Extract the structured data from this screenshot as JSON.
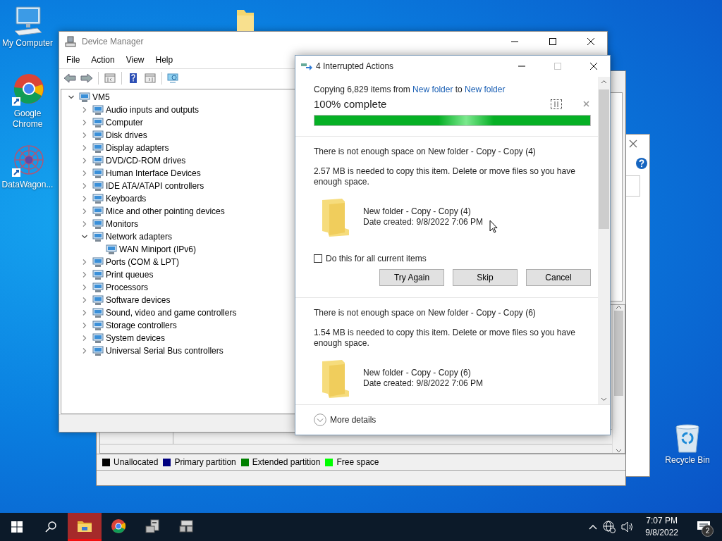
{
  "desktop_icons": [
    {
      "label": "My Computer",
      "kind": "computer"
    },
    {
      "label": "Google Chrome",
      "kind": "browser"
    },
    {
      "label": "DataWagon...",
      "kind": "pattern"
    },
    {
      "label": "Recycle Bin",
      "kind": "recycle"
    }
  ],
  "disk_management": {
    "legend": [
      {
        "label": "Unallocated",
        "color": "#000000"
      },
      {
        "label": "Primary partition",
        "color": "#000080"
      },
      {
        "label": "Extended partition",
        "color": "#008000"
      },
      {
        "label": "Free space",
        "color": "#00ff00"
      }
    ]
  },
  "device_manager": {
    "title": "Device Manager",
    "menu": [
      "File",
      "Action",
      "View",
      "Help"
    ],
    "tree": {
      "label": "VM5",
      "expanded": true,
      "children": [
        {
          "label": "Audio inputs and outputs",
          "expanded": false
        },
        {
          "label": "Computer",
          "expanded": false
        },
        {
          "label": "Disk drives",
          "expanded": false
        },
        {
          "label": "Display adapters",
          "expanded": false
        },
        {
          "label": "DVD/CD-ROM drives",
          "expanded": false
        },
        {
          "label": "Human Interface Devices",
          "expanded": false
        },
        {
          "label": "IDE ATA/ATAPI controllers",
          "expanded": false
        },
        {
          "label": "Keyboards",
          "expanded": false
        },
        {
          "label": "Mice and other pointing devices",
          "expanded": false
        },
        {
          "label": "Monitors",
          "expanded": false
        },
        {
          "label": "Network adapters",
          "expanded": true,
          "children": [
            {
              "label": "WAN Miniport (IPv6)"
            }
          ]
        },
        {
          "label": "Ports (COM & LPT)",
          "expanded": false
        },
        {
          "label": "Print queues",
          "expanded": false
        },
        {
          "label": "Processors",
          "expanded": false
        },
        {
          "label": "Software devices",
          "expanded": false
        },
        {
          "label": "Sound, video and game controllers",
          "expanded": false
        },
        {
          "label": "Storage controllers",
          "expanded": false
        },
        {
          "label": "System devices",
          "expanded": false
        },
        {
          "label": "Universal Serial Bus controllers",
          "expanded": false
        }
      ]
    }
  },
  "copy_dialog": {
    "title": "4 Interrupted Actions",
    "summary": {
      "prefix": "Copying 6,829 items from",
      "source": "New folder",
      "middle": "to",
      "destination": "New folder"
    },
    "status": "100% complete",
    "level": 1.0,
    "conflicts": [
      {
        "heading": "There is not enough space on New folder - Copy - Copy (4)",
        "message": "2.57 MB is needed to copy this item. Delete or move files so you have enough space.",
        "item_name": "New folder - Copy - Copy (4)",
        "date_created": "Date created: 9/8/2022 7:06 PM",
        "apply_to_all": {
          "label": "Do this for all current items",
          "checked": false
        },
        "buttons": [
          "Try Again",
          "Skip",
          "Cancel"
        ]
      },
      {
        "heading": "There is not enough space on New folder - Copy - Copy (6)",
        "message": "1.54 MB is needed to copy this item. Delete or move files so you have enough space.",
        "item_name": "New folder - Copy - Copy (6)",
        "date_created": "Date created: 9/8/2022 7:06 PM"
      }
    ],
    "more_details": "More details"
  },
  "taskbar": {
    "apps": [
      {
        "kind": "explorer",
        "selected": true
      },
      {
        "kind": "browser",
        "selected": false
      },
      {
        "kind": "server",
        "selected": false
      },
      {
        "kind": "server2",
        "selected": false
      }
    ],
    "time": "7:07 PM",
    "date": "9/8/2022",
    "notification_count": "2"
  }
}
